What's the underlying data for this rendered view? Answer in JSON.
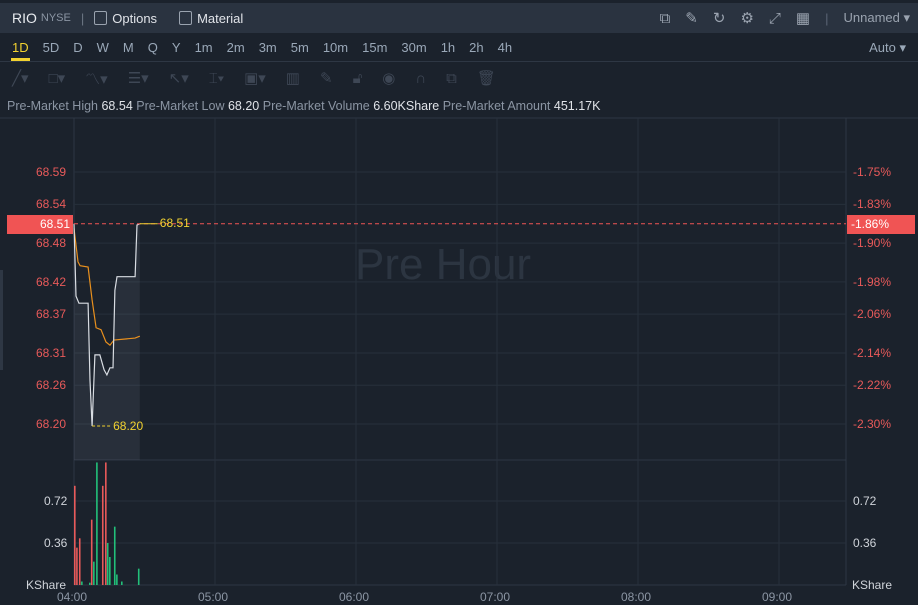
{
  "header": {
    "symbol": "RIO",
    "exchange": "NYSE",
    "options_label": "Options",
    "material_label": "Material",
    "layout_name": "Unnamed"
  },
  "timeframes": [
    "1D",
    "5D",
    "D",
    "W",
    "M",
    "Q",
    "Y",
    "1m",
    "2m",
    "3m",
    "5m",
    "10m",
    "15m",
    "30m",
    "1h",
    "2h",
    "4h"
  ],
  "active_timeframe": "1D",
  "scale_mode": "Auto",
  "info": {
    "high_label": "Pre-Market High",
    "high": "68.54",
    "low_label": "Pre-Market Low",
    "low": "68.20",
    "vol_label": "Pre-Market Volume",
    "vol": "6.60KShare",
    "amt_label": "Pre-Market Amount",
    "amt": "451.17K"
  },
  "watermark": "Pre Hour",
  "colors": {
    "up": "#e85a5a",
    "down": "#22c07a",
    "avg": "#e8901e",
    "price": "#d9dde3",
    "accent": "#f2d230"
  },
  "chart_data": {
    "type": "line",
    "price_ticks_left": [
      "68.59",
      "68.54",
      "68.48",
      "68.42",
      "68.37",
      "68.31",
      "68.26",
      "68.20"
    ],
    "pct_ticks_right": [
      "-1.75%",
      "-1.83%",
      "-1.90%",
      "-1.98%",
      "-2.06%",
      "-2.14%",
      "-2.22%",
      "-2.30%"
    ],
    "current_price": "68.51",
    "current_pct": "-1.86%",
    "high_marker": "68.51",
    "low_marker": "68.20",
    "x_ticks": [
      "04:00",
      "05:00",
      "06:00",
      "07:00",
      "08:00",
      "09:00"
    ],
    "volume_ticks": [
      "0.72",
      "0.36"
    ],
    "volume_unit": "KShare",
    "price_series": [
      [
        0,
        68.51
      ],
      [
        0.85,
        68.398
      ],
      [
        2.1,
        68.387
      ],
      [
        6,
        68.387
      ],
      [
        6.8,
        68.268
      ],
      [
        7.7,
        68.197
      ],
      [
        8.9,
        68.307
      ],
      [
        11,
        68.307
      ],
      [
        12.8,
        68.284
      ],
      [
        14,
        68.276
      ],
      [
        15.3,
        68.287
      ],
      [
        16.6,
        68.287
      ],
      [
        17.4,
        68.407
      ],
      [
        18.3,
        68.428
      ],
      [
        26,
        68.428
      ],
      [
        26.8,
        68.508
      ],
      [
        28,
        68.51
      ]
    ],
    "avg_series": [
      [
        0,
        68.503
      ],
      [
        1.7,
        68.451
      ],
      [
        2.6,
        68.445
      ],
      [
        6,
        68.443
      ],
      [
        7.7,
        68.392
      ],
      [
        9.4,
        68.349
      ],
      [
        11.5,
        68.346
      ],
      [
        13.6,
        68.327
      ],
      [
        15.3,
        68.322
      ],
      [
        17,
        68.33
      ],
      [
        26,
        68.333
      ],
      [
        28,
        68.336
      ]
    ],
    "volume_bars": [
      [
        0,
        0.85,
        "up"
      ],
      [
        0.9,
        0.32,
        "up"
      ],
      [
        2.1,
        0.4,
        "up"
      ],
      [
        3,
        0.03,
        "down"
      ],
      [
        6.4,
        0.02,
        "down"
      ],
      [
        7.2,
        0.56,
        "up"
      ],
      [
        8.1,
        0.2,
        "down"
      ],
      [
        9.4,
        1.05,
        "down"
      ],
      [
        11.9,
        0.85,
        "up"
      ],
      [
        13.2,
        1.05,
        "up"
      ],
      [
        14,
        0.36,
        "down"
      ],
      [
        14.9,
        0.24,
        "down"
      ],
      [
        17,
        0.5,
        "down"
      ],
      [
        17.9,
        0.09,
        "down"
      ],
      [
        20,
        0.03,
        "down"
      ],
      [
        27.2,
        0.14,
        "down"
      ]
    ]
  }
}
